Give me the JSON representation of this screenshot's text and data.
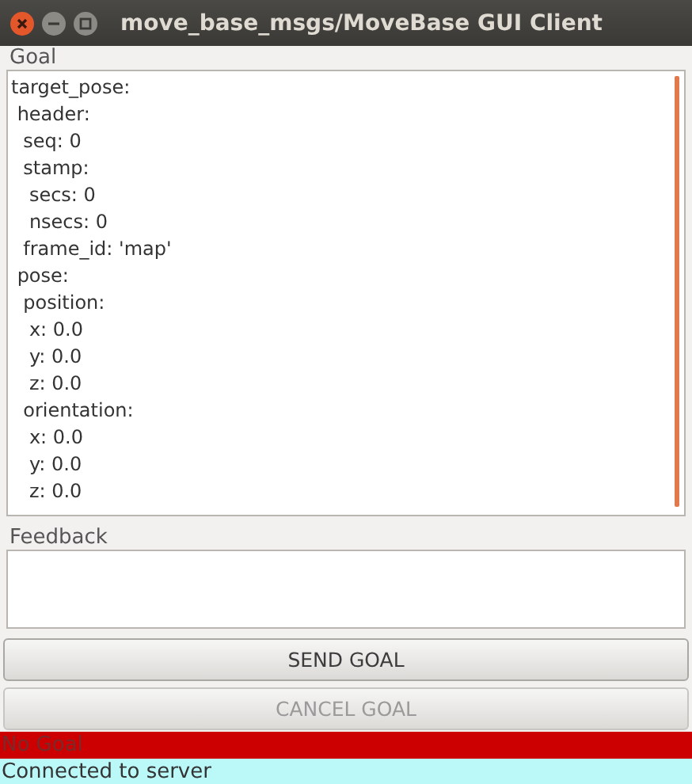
{
  "window": {
    "title": "move_base_msgs/MoveBase GUI Client"
  },
  "goal": {
    "label": "Goal",
    "value": "target_pose:\n header:\n  seq: 0\n  stamp:\n   secs: 0\n   nsecs: 0\n  frame_id: 'map'\n pose:\n  position:\n   x: 0.0\n   y: 0.0\n   z: 0.0\n  orientation:\n   x: 0.0\n   y: 0.0\n   z: 0.0"
  },
  "feedback": {
    "label": "Feedback"
  },
  "buttons": [
    {
      "label": "SEND GOAL",
      "disabled": false
    },
    {
      "label": "CANCEL GOAL",
      "disabled": true
    }
  ],
  "status_lines": [
    {
      "text": "No Goal",
      "color": "#cc0000"
    },
    {
      "text": "Connected to server",
      "color": "#bbf8f8"
    }
  ]
}
